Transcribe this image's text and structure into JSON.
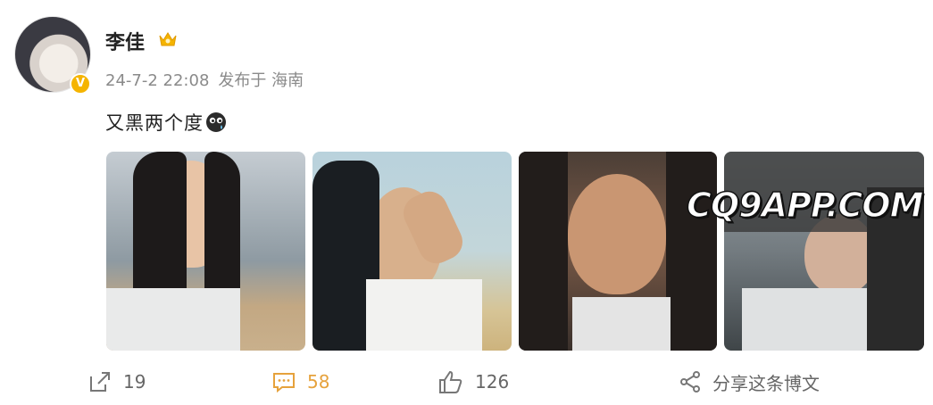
{
  "user": {
    "name": "李佳",
    "verified_badge": "V",
    "vip_icon": "crown-badge-icon"
  },
  "meta": {
    "timestamp": "24-7-2 22:08",
    "location": "发布于 海南"
  },
  "post": {
    "text": "又黑两个度",
    "emoji": "sweat-emoji-icon"
  },
  "photos": [
    {
      "label": "photo-1"
    },
    {
      "label": "photo-2"
    },
    {
      "label": "photo-3"
    },
    {
      "label": "photo-4"
    }
  ],
  "watermark": "CQ9APP.COM",
  "actions": {
    "repost_count": "19",
    "comment_count": "58",
    "like_count": "126",
    "share_label": "分享这条博文"
  },
  "colors": {
    "comment_accent": "#e6a23c",
    "vip": "#f5b400",
    "text": "#222222",
    "meta": "#8a8a8a"
  }
}
